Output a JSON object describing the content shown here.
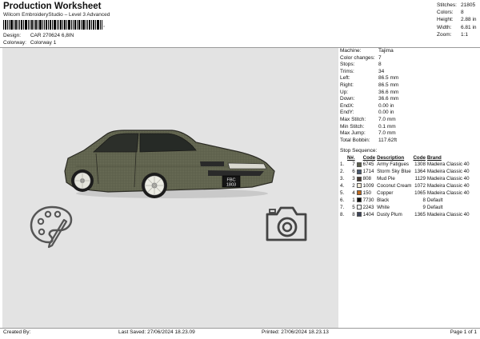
{
  "header": {
    "title": "Production Worksheet",
    "subtitle": "Wilcom EmbroideryStudio – Level 3 Advanced",
    "barcode_suffix": ",",
    "design_label": "Design:",
    "design_value": "CAR 270624 6,8IN",
    "colorway_label": "Colorway:",
    "colorway_value": "Colorway 1"
  },
  "stats": [
    {
      "label": "Stitches:",
      "value": "21805"
    },
    {
      "label": "Colors:",
      "value": "8"
    },
    {
      "label": "Height:",
      "value": "2.88 in"
    },
    {
      "label": "Width:",
      "value": "6.81 in"
    },
    {
      "label": "Zoom:",
      "value": "1:1"
    }
  ],
  "machine_info": [
    {
      "label": "Machine:",
      "value": "Tajima"
    },
    {
      "label": "Color changes:",
      "value": "7"
    },
    {
      "label": "Stops:",
      "value": "8"
    },
    {
      "label": "Trims:",
      "value": "34"
    },
    {
      "label": "Left:",
      "value": "86.5 mm"
    },
    {
      "label": "Right:",
      "value": "86.5 mm"
    },
    {
      "label": "Up:",
      "value": "36.6 mm"
    },
    {
      "label": "Down:",
      "value": "36.6 mm"
    },
    {
      "label": "EndX:",
      "value": "0.00 in"
    },
    {
      "label": "EndY:",
      "value": "0.00 in"
    },
    {
      "label": "Max Stitch:",
      "value": "7.0 mm"
    },
    {
      "label": "Min Stitch:",
      "value": "0.1 mm"
    },
    {
      "label": "Max Jump:",
      "value": "7.0 mm"
    },
    {
      "label": "Total Bobbin:",
      "value": "117.62ft"
    }
  ],
  "stop_sequence": {
    "title": "Stop Sequence:",
    "headers": {
      "n": "N#.",
      "code": "Code",
      "description": "Description",
      "code2": "Code",
      "brand": "Brand"
    },
    "rows": [
      {
        "stop": "1.",
        "n": "7",
        "color": "#5c5f4d",
        "code": "6745",
        "description": "Army Fatigues",
        "code2": "1308",
        "brand": "Madeira Classic 40"
      },
      {
        "stop": "2.",
        "n": "6",
        "color": "#4a5a70",
        "code": "1714",
        "description": "Storm Sky Blue",
        "code2": "1364",
        "brand": "Madeira Classic 40"
      },
      {
        "stop": "3.",
        "n": "3",
        "color": "#4a3c33",
        "code": "808",
        "description": "Mud Pie",
        "code2": "1129",
        "brand": "Madeira Classic 40"
      },
      {
        "stop": "4.",
        "n": "2",
        "color": "#f2ead6",
        "code": "1009",
        "description": "Coconut Cream",
        "code2": "1072",
        "brand": "Madeira Classic 40"
      },
      {
        "stop": "5.",
        "n": "4",
        "color": "#c06a1e",
        "code": "150",
        "description": "Copper",
        "code2": "1065",
        "brand": "Madeira Classic 40"
      },
      {
        "stop": "6.",
        "n": "1",
        "color": "#111111",
        "code": "7730",
        "description": "Black",
        "code2": "8",
        "brand": "Default"
      },
      {
        "stop": "7.",
        "n": "5",
        "color": "#ffffff",
        "code": "2243",
        "description": "White",
        "code2": "9",
        "brand": "Default"
      },
      {
        "stop": "8.",
        "n": "8",
        "color": "#3d4459",
        "code": "1404",
        "description": "Dusty Plum",
        "code2": "1365",
        "brand": "Madeira Classic 40"
      }
    ]
  },
  "design_preview": {
    "plate_text_top": "FBC",
    "plate_text_bottom": "1803",
    "body_color": "#5e614c",
    "icons": [
      "car-embroidery",
      "palette-brush-icon",
      "camera-icon"
    ]
  },
  "footer": {
    "created_by": "Created By:",
    "last_saved": "Last Saved: 27/06/2024 18.23.09",
    "printed": "Printed: 27/06/2024 18.23.13",
    "page": "Page 1 of 1"
  }
}
